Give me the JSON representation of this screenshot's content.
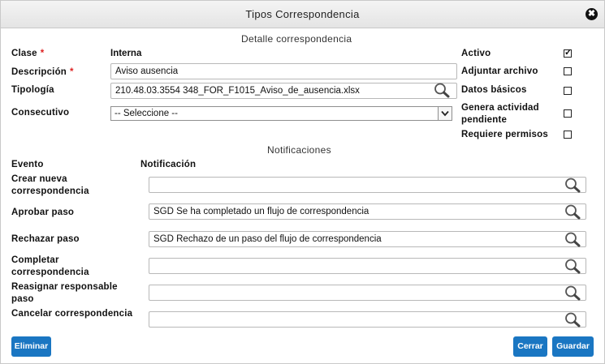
{
  "dialog": {
    "title": "Tipos Correspondencia",
    "close_symbol": "✖"
  },
  "detalle": {
    "section_title": "Detalle correspondencia",
    "clase_label": "Clase",
    "clase_value": "Interna",
    "descripcion_label": "Descripción",
    "descripcion_value": "Aviso ausencia",
    "tipologia_label": "Tipología",
    "tipologia_value": "210.48.03.3554 348_FOR_F1015_Aviso_de_ausencia.xlsx",
    "consecutivo_label": "Consecutivo",
    "consecutivo_value": "-- Seleccione --",
    "required_mark": "*"
  },
  "options": [
    {
      "label": "Activo",
      "checked": true
    },
    {
      "label": "Adjuntar archivo",
      "checked": false
    },
    {
      "label": "Datos básicos",
      "checked": false
    },
    {
      "label": "Genera actividad pendiente",
      "checked": false
    },
    {
      "label": "Requiere permisos",
      "checked": false
    }
  ],
  "notificaciones": {
    "section_title": "Notificaciones",
    "col_evento": "Evento",
    "col_notificacion": "Notificación",
    "rows": [
      {
        "evento": "Crear nueva correspondencia",
        "notificacion": ""
      },
      {
        "evento": "Aprobar paso",
        "notificacion": "SGD Se ha completado un flujo de correspondencia"
      },
      {
        "evento": "Rechazar paso",
        "notificacion": "SGD Rechazo de un paso del flujo de correspondencia"
      },
      {
        "evento": "Completar correspondencia",
        "notificacion": ""
      },
      {
        "evento": "Reasignar responsable paso",
        "notificacion": ""
      },
      {
        "evento": "Cancelar correspondencia",
        "notificacion": ""
      }
    ]
  },
  "buttons": {
    "eliminar": "Eliminar",
    "cerrar": "Cerrar",
    "guardar": "Guardar"
  },
  "colors": {
    "primary_button": "#1a76c2",
    "required": "#dd2222"
  }
}
